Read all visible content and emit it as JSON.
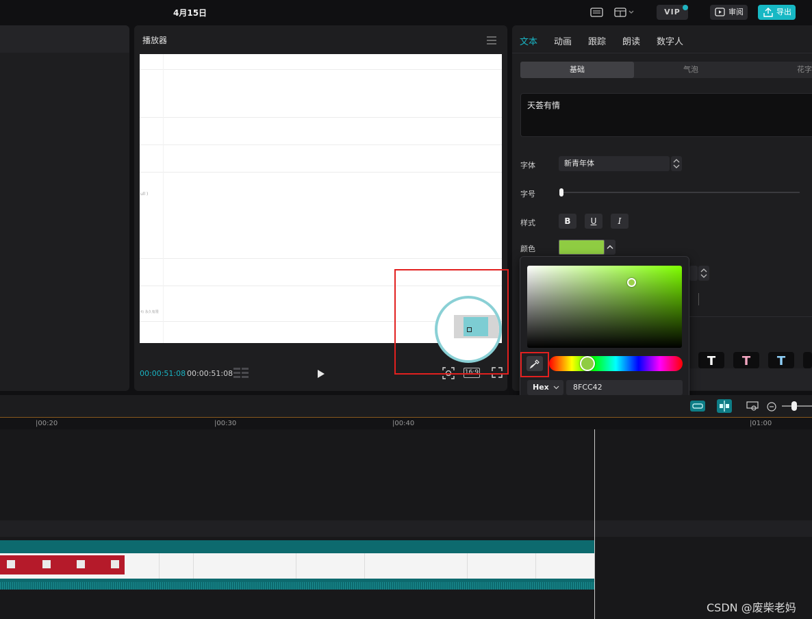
{
  "topbar": {
    "date": "4月15日",
    "vip_label": "VIP",
    "review_label": "审阅",
    "export_label": "导出"
  },
  "player": {
    "title": "播放器",
    "current_time": "00:00:51:08",
    "total_time": "00:00:51:08",
    "ratio": "16:9",
    "frame_note_1": "ull )",
    "frame_note_2": "4) 永久有限"
  },
  "right_panel": {
    "tabs": [
      "文本",
      "动画",
      "跟踪",
      "朗读",
      "数字人"
    ],
    "active_tab": "文本",
    "sub_tabs": [
      "基础",
      "气泡",
      "花字"
    ],
    "text_content": "天荟有情",
    "font_label": "字体",
    "font_value": "新青年体",
    "size_label": "字号",
    "style_label": "样式",
    "style_buttons": [
      "B",
      "U",
      "I"
    ],
    "color_label": "颜色",
    "color_value": "#8FCC42"
  },
  "color_picker": {
    "mode": "Hex",
    "hex_value": "8FCC42",
    "add_label": "+",
    "swatches": [
      "#f9c2c8",
      "#f4908b",
      "#f55b5b",
      "#f01c3b",
      "#ee0000",
      "#c21a1a",
      "#fcd5c7",
      "#f9b48e",
      "#f08b48",
      "#f58a21",
      "#f5740a",
      "#a8503b",
      "#f8f2c3",
      "#fde98e",
      "#fde100",
      "#f9bf1a",
      "#f8a400",
      "#a8733d",
      "#fbd4e6",
      "#f9a7c4",
      "#f55a95",
      "#f02380",
      "#f200f5",
      "#8f1f5d",
      "#e8e0f8",
      "#c8c0f4",
      "#8e86e8",
      "#8c57f5",
      "#7d3cf2",
      "#4a3ca0",
      "#b8dcfa",
      "#8cbdf5",
      "#4fa0f2",
      "#0c7af5",
      "#1536f0",
      "#2c4c9c",
      "#bff0ef",
      "#92e5ea",
      "#4fd4dc",
      "#1ec6e8",
      "#0aa6da",
      "#0a6c92",
      "#c6f2d8",
      "#8ee8b8",
      "#2ee07c",
      "#12d24e",
      "#0af03a",
      "#17833c",
      "#f1f0c8"
    ]
  },
  "timeline": {
    "ticks": [
      "|00:20",
      "|00:30",
      "|00:40",
      "|01:00"
    ]
  },
  "watermark": "CSDN @废柴老妈",
  "colors": {
    "accent": "#19b4c3",
    "highlight": "#e2201f",
    "panel": "#1e1e20"
  }
}
